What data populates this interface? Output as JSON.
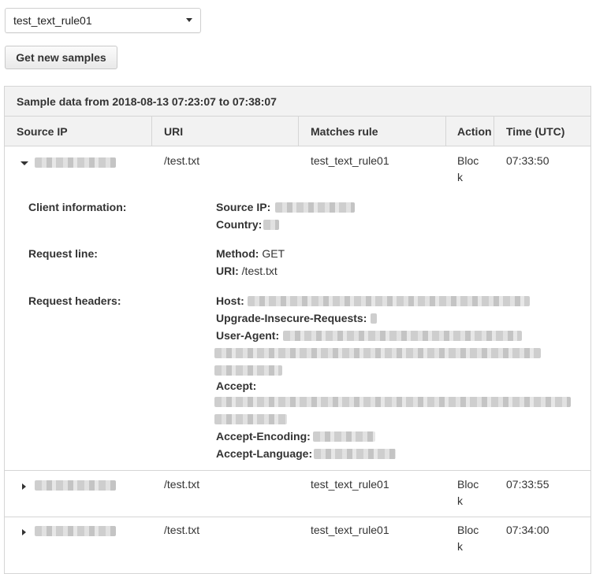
{
  "rule_select": {
    "value": "test_text_rule01"
  },
  "toolbar": {
    "get_samples_label": "Get new samples"
  },
  "panel": {
    "title": "Sample data from 2018-08-13 07:23:07 to 07:38:07",
    "columns": [
      "Source IP",
      "URI",
      "Matches rule",
      "Action",
      "Time (UTC)"
    ]
  },
  "rows": [
    {
      "uri": "/test.txt",
      "rule": "test_text_rule01",
      "action_line1": "Bloc",
      "action_line2": "k",
      "time": "07:33:50",
      "expanded": true
    },
    {
      "uri": "/test.txt",
      "rule": "test_text_rule01",
      "action_line1": "Bloc",
      "action_line2": "k",
      "time": "07:33:55",
      "expanded": false
    },
    {
      "uri": "/test.txt",
      "rule": "test_text_rule01",
      "action_line1": "Bloc",
      "action_line2": "k",
      "time": "07:34:00",
      "expanded": false
    }
  ],
  "details": {
    "client_info_label": "Client information:",
    "source_ip_key": "Source IP:",
    "country_key": "Country:",
    "request_line_label": "Request line:",
    "method_key": "Method:",
    "method_value": "GET",
    "uri_key": "URI:",
    "uri_value": "/test.txt",
    "request_headers_label": "Request headers:",
    "host_key": "Host:",
    "upgrade_key": "Upgrade-Insecure-Requests:",
    "user_agent_key": "User-Agent:",
    "accept_key": "Accept:",
    "accept_encoding_key": "Accept-Encoding:",
    "accept_language_key": "Accept-Language:"
  }
}
